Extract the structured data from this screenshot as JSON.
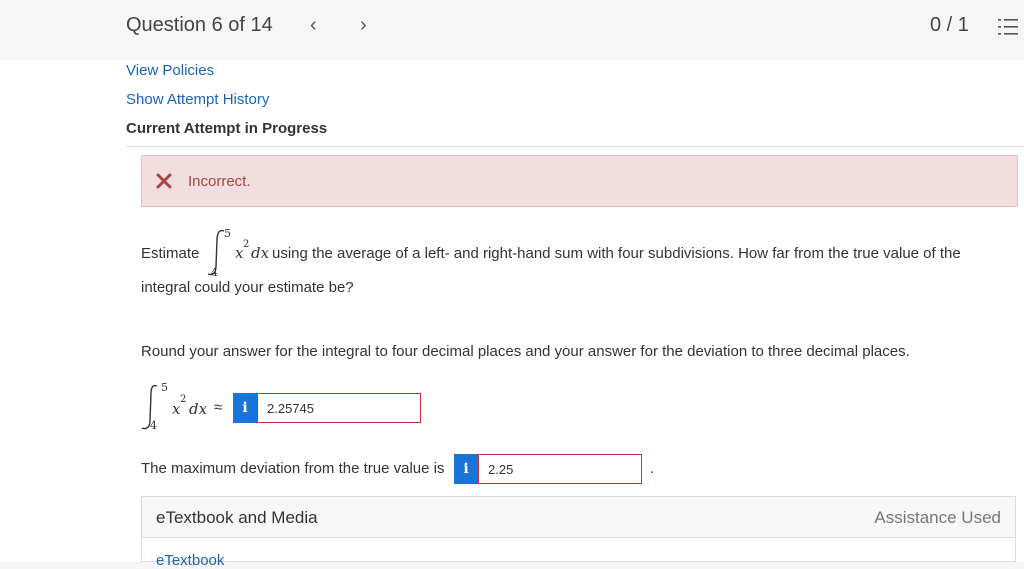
{
  "header": {
    "question_label": "Question 6 of 14",
    "prev_icon": "chevron-left-icon",
    "next_icon": "chevron-right-icon",
    "score": "0 / 1",
    "list_icon": "numbered-list-icon"
  },
  "links": {
    "view_policies": "View Policies",
    "show_attempt_history": "Show Attempt History"
  },
  "attempt_status": "Current Attempt in Progress",
  "feedback": {
    "icon": "x-mark-icon",
    "text": "Incorrect.",
    "color": "#a94442",
    "background": "#f2dede"
  },
  "question": {
    "estimate_word": "Estimate",
    "integral_lower": "4",
    "integral_upper": "5",
    "integrand_base": "x",
    "integrand_exponent": "2",
    "differential": "dx",
    "line1_rest": "using the average of a left- and right-hand sum with four subdivisions. How far from the true value of the",
    "line2": "integral could your estimate be?",
    "rounding_instruction": "Round your answer for the integral to four decimal places and your answer for the deviation to three decimal places."
  },
  "answer1": {
    "approx_symbol": "≈",
    "info_label": "i",
    "value": "2.25745"
  },
  "answer2": {
    "label": "The maximum deviation from the true value is",
    "info_label": "i",
    "value": "2.25",
    "trailing": "."
  },
  "etextbook": {
    "title": "eTextbook and Media",
    "assistance": "Assistance Used",
    "link": "eTextbook"
  },
  "colors": {
    "link": "#1a64b8",
    "info_button": "#1a73d9",
    "error_border": "#c9302c"
  }
}
